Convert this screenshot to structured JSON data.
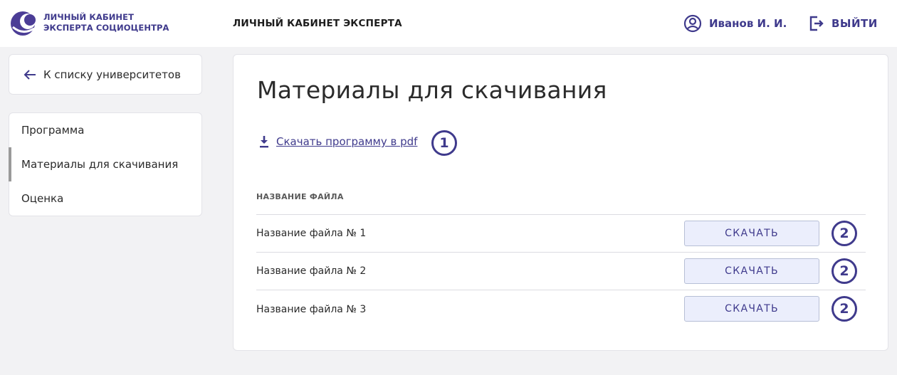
{
  "header": {
    "logo_line1": "ЛИЧНЫЙ КАБИНЕТ",
    "logo_line2": "ЭКСПЕРТА СОЦИОЦЕНТРА",
    "title": "ЛИЧНЫЙ КАБИНЕТ ЭКСПЕРТА",
    "user_name": "Иванов И. И.",
    "user_icon": "user-circle-icon",
    "logout_label": "ВЫЙТИ",
    "logout_icon": "logout-icon"
  },
  "sidebar": {
    "back_label": "К списку университетов",
    "back_icon": "arrow-left-icon",
    "items": [
      {
        "label": "Программа",
        "active": false
      },
      {
        "label": "Материалы для скачивания",
        "active": true
      },
      {
        "label": "Оценка",
        "active": false
      }
    ]
  },
  "main": {
    "title": "Материалы для скачивания",
    "pdf_link": "Скачать программу в pdf",
    "pdf_icon": "download-icon",
    "pdf_marker": "1",
    "table_header": "НАЗВАНИЕ ФАЙЛА",
    "files": [
      {
        "name": "Название файла № 1",
        "button": "СКАЧАТЬ",
        "marker": "2"
      },
      {
        "name": "Название файла № 2",
        "button": "СКАЧАТЬ",
        "marker": "2"
      },
      {
        "name": "Название файла № 3",
        "button": "СКАЧАТЬ",
        "marker": "2"
      }
    ]
  },
  "colors": {
    "accent": "#3f3a8c",
    "button_bg": "#ebeefc",
    "page_bg": "#f2f2f4"
  }
}
